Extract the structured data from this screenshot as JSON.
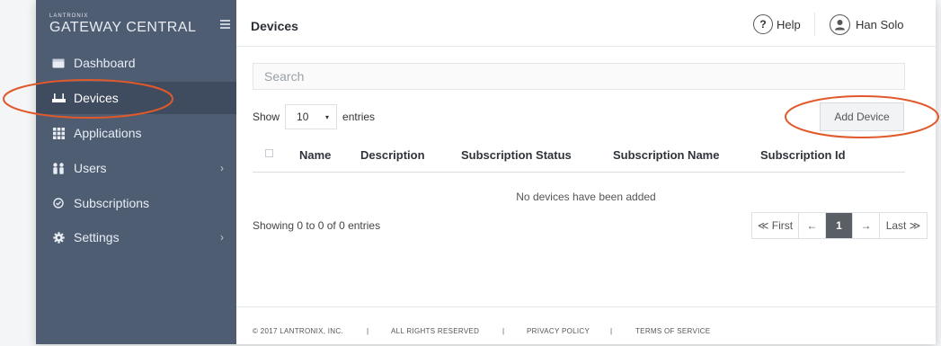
{
  "brand": {
    "small": "LANTRONIX",
    "big": "GATEWAY CENTRAL"
  },
  "sidebar": {
    "items": [
      {
        "label": "Dashboard",
        "icon": "dashboard-icon"
      },
      {
        "label": "Devices",
        "icon": "router-icon",
        "active": true
      },
      {
        "label": "Applications",
        "icon": "grid-icon"
      },
      {
        "label": "Users",
        "icon": "users-icon",
        "chevron": "›"
      },
      {
        "label": "Subscriptions",
        "icon": "check-circle-icon"
      },
      {
        "label": "Settings",
        "icon": "gear-icon",
        "chevron": "›"
      }
    ]
  },
  "header": {
    "title": "Devices",
    "help_label": "Help",
    "help_symbol": "?",
    "user_name": "Han Solo"
  },
  "search": {
    "placeholder": "Search"
  },
  "table_controls": {
    "show_label": "Show",
    "entries_value": "10",
    "caret": "▾",
    "entries_label": "entries",
    "add_button": "Add Device"
  },
  "table": {
    "columns": [
      "Name",
      "Description",
      "Subscription Status",
      "Subscription Name",
      "Subscription Id"
    ],
    "empty_message": "No devices have been added",
    "info": "Showing 0 to 0 of 0 entries"
  },
  "pagination": {
    "first": "≪ First",
    "prev": "←",
    "current": "1",
    "next": "→",
    "last": "Last ≫"
  },
  "footer": {
    "copyright": "© 2017 LANTRONIX, INC.",
    "rights": "ALL RIGHTS RESERVED",
    "privacy": "PRIVACY POLICY",
    "terms": "TERMS OF SERVICE",
    "separator": "|"
  },
  "colors": {
    "sidebar": "#4f5d73",
    "sidebar_active": "#3f4b5f",
    "annotation": "#e0592a",
    "pager_active": "#5a5f66"
  }
}
